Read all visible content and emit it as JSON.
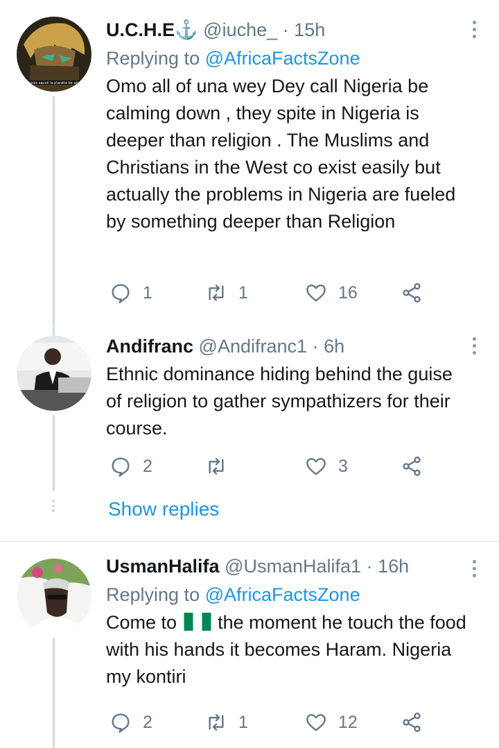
{
  "tweets": [
    {
      "name": "U.C.H.E",
      "name_emoji": "⚓",
      "handle": "@iuche_",
      "time": "15h",
      "replying_prefix": "Replying to",
      "replying_to": "@AfricaFactsZone",
      "text": "Omo all of una wey Dey call Nigeria be calming down , they spite in Nigeria is deeper than religion . The Muslims and Christians in the West co exist easily but actually the problems in Nigeria are fueled by something deeper than Religion",
      "avatar_caption": "unes sauvé la planète be alo",
      "replies": "1",
      "retweets": "1",
      "likes": "16"
    },
    {
      "name": "Andifranc",
      "handle": "@Andifranc1",
      "time": "6h",
      "text": "Ethnic dominance hiding behind the guise of religion to gather sympathizers for their course.",
      "replies": "2",
      "retweets": "",
      "likes": "3"
    },
    {
      "name": "UsmanHalifa",
      "handle": "@UsmanHalifa1",
      "time": "16h",
      "replying_prefix": "Replying to",
      "replying_to": "@AfricaFactsZone",
      "text_before_flag": "Come to",
      "text_after_flag": "the moment he touch the food with his hands it becomes Haram. Nigeria my kontiri",
      "replies": "2",
      "retweets": "1",
      "likes": "12"
    }
  ],
  "show_replies_label": "Show replies",
  "colors": {
    "link": "#1b95e0",
    "secondary_text": "#657786",
    "thread_line": "#cfd9de",
    "divider": "#e1e8ed",
    "flag_green": "#008751"
  }
}
